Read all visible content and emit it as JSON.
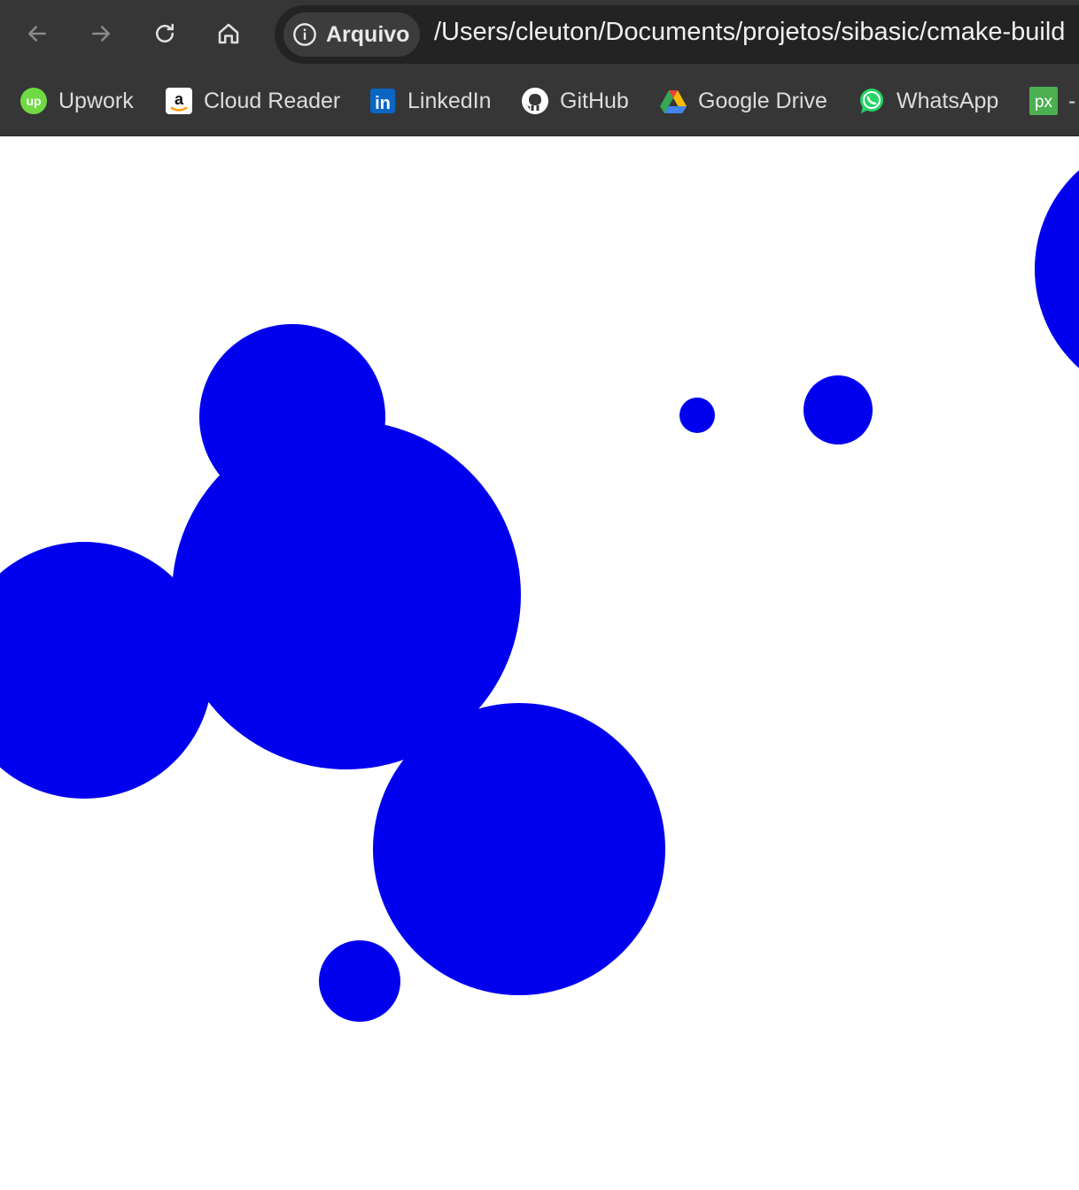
{
  "nav": {
    "back": "back-icon",
    "forward": "forward-icon",
    "reload": "reload-icon",
    "home": "home-icon"
  },
  "omnibox": {
    "chip_label": "Arquivo",
    "url": "/Users/cleuton/Documents/projetos/sibasic/cmake-build"
  },
  "bookmarks": [
    {
      "label": "Upwork",
      "icon": "upwork-icon"
    },
    {
      "label": "Cloud Reader",
      "icon": "amazon-icon"
    },
    {
      "label": "LinkedIn",
      "icon": "linkedin-icon"
    },
    {
      "label": "GitHub",
      "icon": "github-icon"
    },
    {
      "label": "Google Drive",
      "icon": "google-drive-icon"
    },
    {
      "label": "WhatsApp",
      "icon": "whatsapp-icon"
    },
    {
      "label": "-",
      "icon": "px-icon"
    }
  ],
  "colors": {
    "circle_fill": "#0000ee",
    "toolbar_bg": "#363636",
    "upwork_green": "#6fda44",
    "linkedin_blue": "#0a66c2",
    "whatsapp_green": "#25d366"
  }
}
